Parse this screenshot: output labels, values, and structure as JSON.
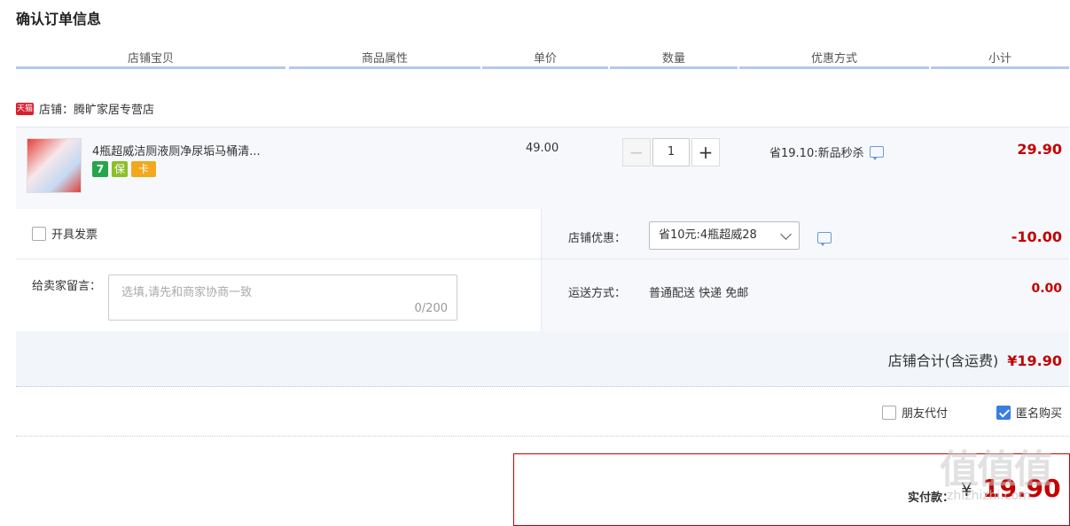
{
  "page": {
    "title": "确认订单信息"
  },
  "table_headers": [
    "店铺宝贝",
    "商品属性",
    "单价",
    "数量",
    "优惠方式",
    "小计"
  ],
  "shop": {
    "badge": "天猫",
    "label": "店铺：",
    "name": "腾旷家居专营店"
  },
  "item": {
    "name": "4瓶超威洁厕液厕净尿垢马桶清...",
    "price": "49.00",
    "quantity": "1",
    "minus": "−",
    "plus": "+",
    "promo": "省19.10:新品秒杀",
    "subtotal": "29.90",
    "tags": [
      "7",
      "保",
      "卡"
    ]
  },
  "invoice": {
    "label": "开具发票",
    "checked": false
  },
  "message": {
    "label": "给卖家留言：",
    "placeholder": "选填,请先和商家协商一致",
    "count": "0/200"
  },
  "shop_discount": {
    "label": "店铺优惠：",
    "selected": "省10元:4瓶超威28",
    "amount": "-10.00"
  },
  "shipping": {
    "label": "运送方式：",
    "value": "普通配送 快递 免邮",
    "amount": "0.00"
  },
  "shop_total": {
    "label": "店铺合计(含运费)",
    "amount": "¥19.90"
  },
  "options": {
    "friend_pay": "朋友代付",
    "anonymous": "匿名购买"
  },
  "payment": {
    "label": "实付款：",
    "currency": "¥",
    "amount": "19.90"
  },
  "watermark": {
    "text": "值值值",
    "url": "zhizhizhi.com"
  },
  "colors": {
    "price_red": "#c40000",
    "header_line": "#b2cbea",
    "checkbox_blue": "#3a7de3"
  }
}
